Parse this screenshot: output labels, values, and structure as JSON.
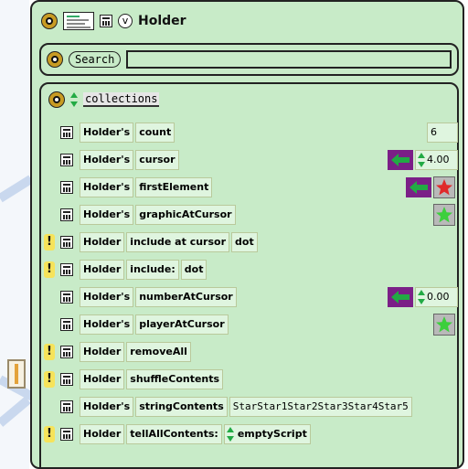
{
  "window": {
    "title": "Holder",
    "v_label": "v"
  },
  "search": {
    "button_label": "Search",
    "value": ""
  },
  "category": {
    "label": "collections"
  },
  "rows": [
    {
      "tiles": [
        "Holder's",
        "count"
      ],
      "value": "6"
    },
    {
      "tiles": [
        "Holder's",
        "cursor"
      ],
      "value": "4.00"
    },
    {
      "tiles": [
        "Holder's",
        "firstElement"
      ]
    },
    {
      "tiles": [
        "Holder's",
        "graphicAtCursor"
      ]
    },
    {
      "tiles": [
        "Holder",
        "include at cursor",
        "dot"
      ],
      "warning": "!"
    },
    {
      "tiles": [
        "Holder",
        "include:",
        "dot"
      ],
      "warning": "!"
    },
    {
      "tiles": [
        "Holder's",
        "numberAtCursor"
      ],
      "value": "0.00"
    },
    {
      "tiles": [
        "Holder's",
        "playerAtCursor"
      ]
    },
    {
      "tiles": [
        "Holder",
        "removeAll"
      ],
      "warning": "!"
    },
    {
      "tiles": [
        "Holder",
        "shuffleContents"
      ],
      "warning": "!"
    },
    {
      "tiles": [
        "Holder's",
        "stringContents",
        "StarStar1Star2Star3Star4Star5"
      ]
    },
    {
      "tiles": [
        "Holder",
        "tellAllContents:",
        "emptyScript"
      ],
      "warning": "!"
    }
  ],
  "colors": {
    "panel_bg": "#c8ebc8",
    "tile_bg": "#dff5df",
    "arrow_green": "#22aa44",
    "arrow_box": "#7b1f87",
    "warning_yellow": "#f6e35a",
    "star_red": "#e02a2a",
    "star_green": "#3ccf3c"
  },
  "icons": {
    "menu_handle": "halo-menu-icon",
    "thumbnail": "holder-thumbnail-icon",
    "tile_maker": "calculator-icon",
    "updown": "up-down-arrows-icon",
    "assign": "green-left-arrow-icon",
    "star_red": "red-star-icon",
    "star_green": "green-star-icon"
  }
}
